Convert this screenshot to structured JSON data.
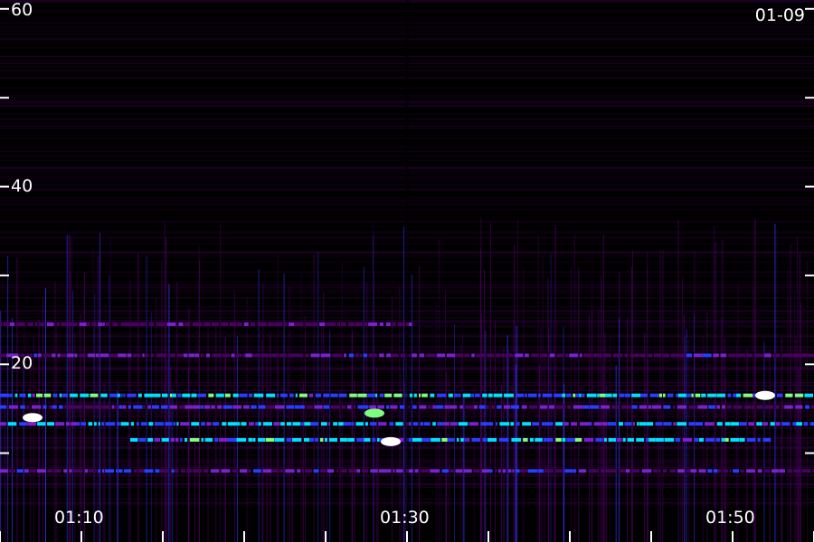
{
  "date_label": "01-09",
  "chart_data": {
    "type": "heatmap",
    "title": "",
    "xlabel": "",
    "ylabel": "",
    "x_range": [
      "01:05",
      "01:55"
    ],
    "y_range": [
      0,
      61
    ],
    "x_tick_labels": [
      "01:10",
      "01:30",
      "01:50"
    ],
    "x_tick_label_values": [
      "01:10",
      "01:30",
      "01:50"
    ],
    "x_minor_tick_values": [
      "01:05",
      "01:10",
      "01:15",
      "01:20",
      "01:25",
      "01:30",
      "01:35",
      "01:40",
      "01:45",
      "01:50",
      "01:55"
    ],
    "y_tick_labels": [
      "20",
      "40",
      "60"
    ],
    "y_tick_values": [
      10,
      20,
      30,
      40,
      50,
      60
    ],
    "grid": false,
    "colormap": [
      "#000000",
      "#4a0060",
      "#7b1fd0",
      "#2a3cff",
      "#00e0ff",
      "#7dff7d",
      "#ffffff"
    ],
    "bands": [
      {
        "y": 21,
        "x_start": "01:05",
        "x_end": "01:55",
        "level": 0.45
      },
      {
        "y": 16.5,
        "x_start": "01:05",
        "x_end": "01:55",
        "level": 0.85
      },
      {
        "y": 15.2,
        "x_start": "01:05",
        "x_end": "01:55",
        "level": 0.55
      },
      {
        "y": 13.3,
        "x_start": "01:05",
        "x_end": "01:55",
        "level": 0.75
      },
      {
        "y": 11.5,
        "x_start": "01:13",
        "x_end": "01:52",
        "level": 0.8
      },
      {
        "y": 8.0,
        "x_start": "01:05",
        "x_end": "01:55",
        "level": 0.5
      },
      {
        "y": 24.5,
        "x_start": "01:05",
        "x_end": "01:30",
        "level": 0.4
      }
    ],
    "hotspots": [
      {
        "x": "01:07",
        "y": 14,
        "level": 1.0
      },
      {
        "x": "01:29",
        "y": 11.3,
        "level": 1.0
      },
      {
        "x": "01:28",
        "y": 14.5,
        "level": 0.85
      },
      {
        "x": "01:52",
        "y": 16.5,
        "level": 0.95
      }
    ]
  }
}
